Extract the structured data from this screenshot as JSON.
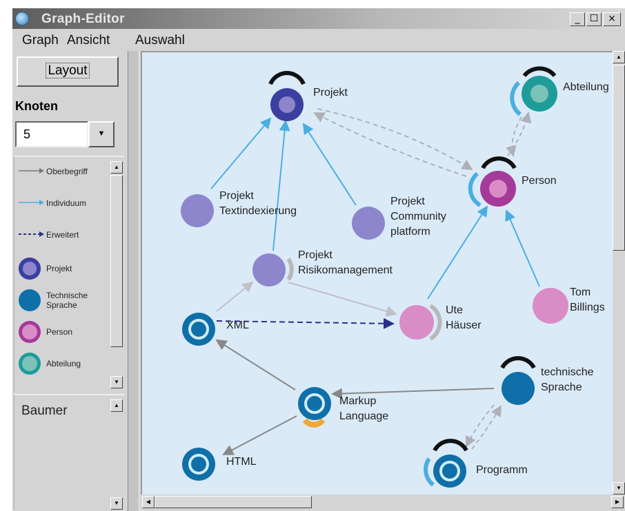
{
  "window": {
    "title": "Graph-Editor",
    "minimize_glyph": "_",
    "maximize_glyph": "☐",
    "close_glyph": "×"
  },
  "menu": {
    "items": [
      "Graph",
      "Ansicht",
      "Auswahl"
    ]
  },
  "sidebar": {
    "layout_button": "Layout",
    "knoten_label": "Knoten",
    "knoten_value": "5",
    "legend": [
      {
        "label": "Oberbegriff",
        "kind": "arrow-gray"
      },
      {
        "label": "Individuum",
        "kind": "arrow-blue"
      },
      {
        "label": "Erweitert",
        "kind": "arrow-dashed"
      },
      {
        "label": "Projekt",
        "kind": "node",
        "color": "#3a3fa0"
      },
      {
        "label": "Technische\nSprache",
        "kind": "node",
        "color": "#0f6fa8"
      },
      {
        "label": "Person",
        "kind": "node",
        "color": "#a43a9a"
      },
      {
        "label": "Abteilung",
        "kind": "node",
        "color": "#1d9c9a"
      }
    ],
    "tree_root": "Baumer"
  },
  "graph": {
    "colors": {
      "projekt": "#3a3fa0",
      "projekt_light": "#8e86cc",
      "sprache": "#0f6fa8",
      "person": "#a43a9a",
      "person_light": "#d98cc6",
      "abteilung": "#1d9c9a",
      "edge_blue": "#4aaee0",
      "edge_gray": "#888888",
      "edge_light": "#c0c0c8",
      "edge_dashed_gray": "#b0b0b8",
      "edge_dashed_navy": "#2b2e8c",
      "orange_badge": "#f0a830",
      "canvas": "#dbeaf7"
    },
    "nodes": {
      "projekt": "Projekt",
      "abteilung": "Abteilung",
      "person": "Person",
      "textindex": "Projekt\nTextindexierung",
      "community": "Projekt\nCommunity\nplatform",
      "risiko": "Projekt\nRisikomanagement",
      "xml": "XML",
      "ute": "Ute\nHäuser",
      "tom": "Tom\nBillings",
      "markup": "Markup\nLanguage",
      "techsprache": "technische\nSprache",
      "html": "HTML",
      "programm": "Programm"
    }
  }
}
